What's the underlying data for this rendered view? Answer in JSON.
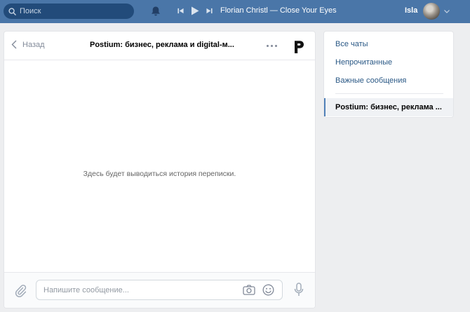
{
  "topbar": {
    "search_placeholder": "Поиск",
    "track": "Florian Christl — Close Your Eyes",
    "user_name": "Isla"
  },
  "chat": {
    "back_label": "Назад",
    "title": "Postium: бизнес, реклама и digital-м...",
    "empty_text": "Здесь будет выводиться история переписки.",
    "input_placeholder": "Напишите сообщение..."
  },
  "nav": {
    "items": [
      {
        "label": "Все чаты"
      },
      {
        "label": "Непрочитанные"
      },
      {
        "label": "Важные сообщения"
      }
    ],
    "active_chat": "Postium: бизнес, реклама ..."
  },
  "colors": {
    "header_bg": "#4a76a8",
    "search_bg": "#224b7a",
    "page_bg": "#edeef0",
    "link": "#2a5885",
    "active_indicator": "#5181b8"
  },
  "icons": [
    "search-icon",
    "bell-icon",
    "prev-track-icon",
    "play-icon",
    "next-track-icon",
    "chevron-down-icon",
    "back-chevron-icon",
    "more-icon",
    "postium-logo",
    "attach-icon",
    "camera-icon",
    "emoji-icon",
    "mic-icon"
  ]
}
